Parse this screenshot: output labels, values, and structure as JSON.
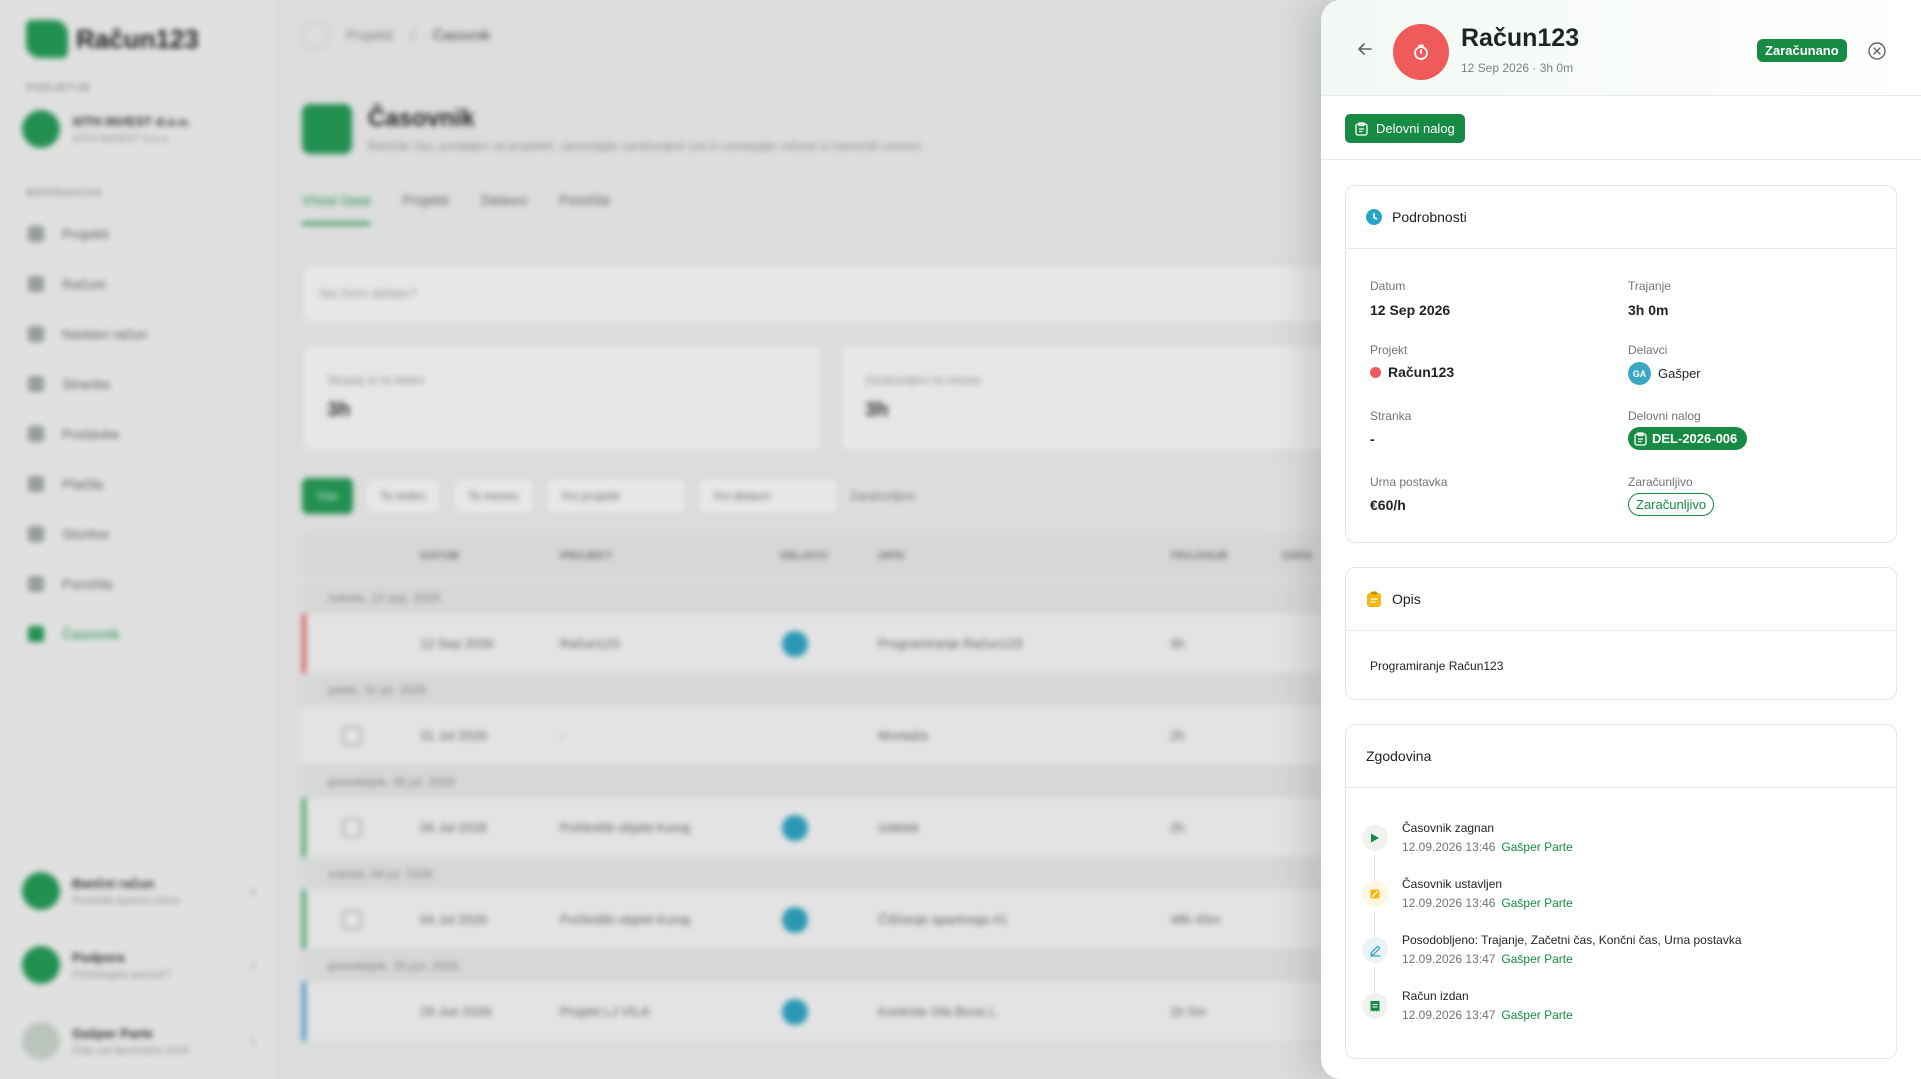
{
  "background": {
    "logo": "Račun123",
    "section_company": "PODJETJE",
    "company_name": "XITH INVEST d.o.o.",
    "company_sub": "XITH INVEST d.o.o.",
    "section_nav": "NAVIGACIJA",
    "nav": [
      "Projekti",
      "Računi",
      "Nastavi račun",
      "Stranke",
      "Postavke",
      "Plačila",
      "Storitve",
      "Poročila",
      "Časovnik"
    ],
    "bottom": [
      {
        "t1": "Bančni račun",
        "t2": "Povežite bančni račun"
      },
      {
        "t1": "Podpora",
        "t2": "Potrebujete pomoč?"
      },
      {
        "t1": "Gašper Parte",
        "t2": "Član od decembra 2025"
      }
    ],
    "breadcrumb": [
      "Projekti",
      "Časovnik"
    ],
    "page_title": "Časovnik",
    "page_sub": "Beležite čas, porabljen na projektih, spremljajte zaračunljive ure in ustvarjajte račune iz časovnih vnosov.",
    "tabs": [
      "Vnosi časa",
      "Projekti",
      "Delavci",
      "Poročila"
    ],
    "search_placeholder": "Na čem delate?",
    "stats": [
      {
        "label": "Skupaj ur ta teden",
        "value": "3h"
      },
      {
        "label": "Zaračunljivo ta mesec",
        "value": "3h"
      }
    ],
    "filters": [
      "Vse",
      "Ta teden",
      "Ta mesec",
      "Vsi projekti",
      "Vsi delavci",
      "Zaračunljivo"
    ],
    "columns": [
      "DATUM",
      "PROJEKT",
      "DELAVCI",
      "OPIS",
      "TRAJANJE",
      "ZARA"
    ],
    "groups": [
      {
        "label": "sobota, 12 sep. 2026",
        "row": {
          "date": "12 Sep 2026",
          "project": "Račun123",
          "desc": "Programiranje Račun123",
          "dur": "3h"
        }
      },
      {
        "label": "petek, 31 jul. 2026",
        "row": {
          "date": "31 Jul 2026",
          "project": "-",
          "desc": "Montaža",
          "dur": "2h"
        }
      },
      {
        "label": "ponedeljek, 06 jul. 2026",
        "row": {
          "date": "06 Jul 2026",
          "project": "Počitniški objekt Kunaj",
          "desc": "Izdelek",
          "dur": "2h"
        }
      },
      {
        "label": "sobota, 04 jul. 2026",
        "row": {
          "date": "04 Jul 2026",
          "project": "Počitniški objekt Kunaj",
          "desc": "Čiščenje apartmaja #1",
          "dur": "48h 45m"
        }
      },
      {
        "label": "ponedeljek, 29 jun. 2026",
        "row": {
          "date": "29 Jun 2026",
          "project": "Projekt LJ VILA",
          "desc": "Kontrola Vila Bova L.",
          "dur": "1h 5m"
        }
      }
    ]
  },
  "drawer": {
    "title": "Račun123",
    "subtitle": "12 Sep 2026 · 3h 0m",
    "status_badge": "Zaračunano",
    "work_order_button": "Delovni nalog",
    "details": {
      "heading": "Podrobnosti",
      "fields": {
        "date_label": "Datum",
        "date_value": "12 Sep 2026",
        "duration_label": "Trajanje",
        "duration_value": "3h 0m",
        "project_label": "Projekt",
        "project_value": "Račun123",
        "workers_label": "Delavci",
        "worker_initials": "GA",
        "worker_name": "Gašper",
        "client_label": "Stranka",
        "client_value": "-",
        "work_order_label": "Delovni nalog",
        "work_order_value": "DEL-2026-006",
        "rate_label": "Urna postavka",
        "rate_value": "€60/h",
        "billable_label": "Zaračunljivo",
        "billable_value": "Zaračunljivo"
      }
    },
    "description": {
      "heading": "Opis",
      "text": "Programiranje Račun123"
    },
    "history": {
      "heading": "Zgodovina",
      "items": [
        {
          "title": "Časovnik zagnan",
          "time": "12.09.2026 13:46",
          "user": "Gašper Parte",
          "icon": "play-icon",
          "color": "#178a43"
        },
        {
          "title": "Časovnik ustavljen",
          "time": "12.09.2026 13:46",
          "user": "Gašper Parte",
          "icon": "stop-icon",
          "color": "#f2b90f"
        },
        {
          "title": "Posodobljeno: Trajanje, Začetni čas, Končni čas, Urna postavka",
          "time": "12.09.2026 13:47",
          "user": "Gašper Parte",
          "icon": "pencil-icon",
          "color": "#3aa0bf"
        },
        {
          "title": "Račun izdan",
          "time": "12.09.2026 13:47",
          "user": "Gašper Parte",
          "icon": "invoice-icon",
          "color": "#178a43"
        }
      ]
    },
    "colors": {
      "accent": "#178a43",
      "timer": "#ef5b5b",
      "details_icon": "#2aa6c5",
      "notes_icon": "#f2b90f"
    }
  }
}
